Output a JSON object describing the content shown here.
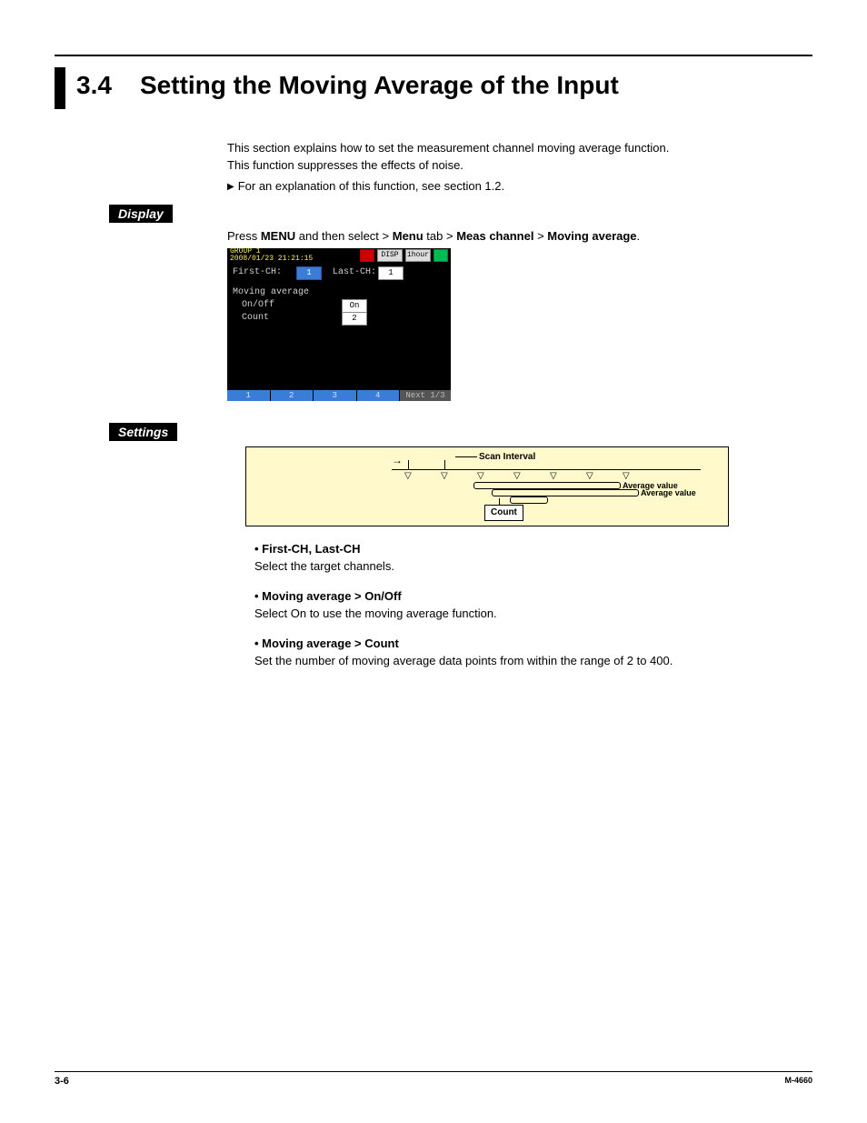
{
  "section": {
    "number": "3.4",
    "title": "Setting the Moving Average of the Input"
  },
  "intro": {
    "line1": "This section explains how to set the measurement channel moving average function.",
    "line2": "This function suppresses the effects of noise.",
    "ref": "For an explanation of this function, see section 1.2."
  },
  "labels": {
    "display": "Display",
    "settings": "Settings"
  },
  "nav": {
    "prefix": "Press ",
    "menu": "MENU",
    "mid1": " and then select > ",
    "t1": "Menu",
    "mid2": " tab > ",
    "t2": "Meas channel",
    "mid3": " > ",
    "t3": "Moving average",
    "suffix": "."
  },
  "device": {
    "group": "GROUP 1",
    "timestamp": "2008/01/23 21:21:15",
    "badge1": "DISP",
    "badge2": "1hour",
    "first_lbl": "First-CH:",
    "first_val": "1",
    "last_lbl": "Last-CH:",
    "last_val": "1",
    "ma_title": "Moving average",
    "onoff_lbl": "On/Off",
    "onoff_val": "On",
    "count_lbl": "Count",
    "count_val": "2",
    "tabs": [
      "1",
      "2",
      "3",
      "4"
    ],
    "next": "Next 1/3"
  },
  "diagram": {
    "scan_interval": "Scan Interval",
    "avg1": "Average value",
    "avg2": "Average value",
    "count": "Count"
  },
  "bullets": {
    "b1_t": "First-CH, Last-CH",
    "b1_d": "Select the target channels.",
    "b2_t": "Moving average > On/Off",
    "b2_d": "Select On to use the moving average function.",
    "b3_t": "Moving average > Count",
    "b3_d": "Set the number of moving average data points from within the range of 2 to 400."
  },
  "footer": {
    "page": "3-6",
    "doc": "M-4660"
  }
}
